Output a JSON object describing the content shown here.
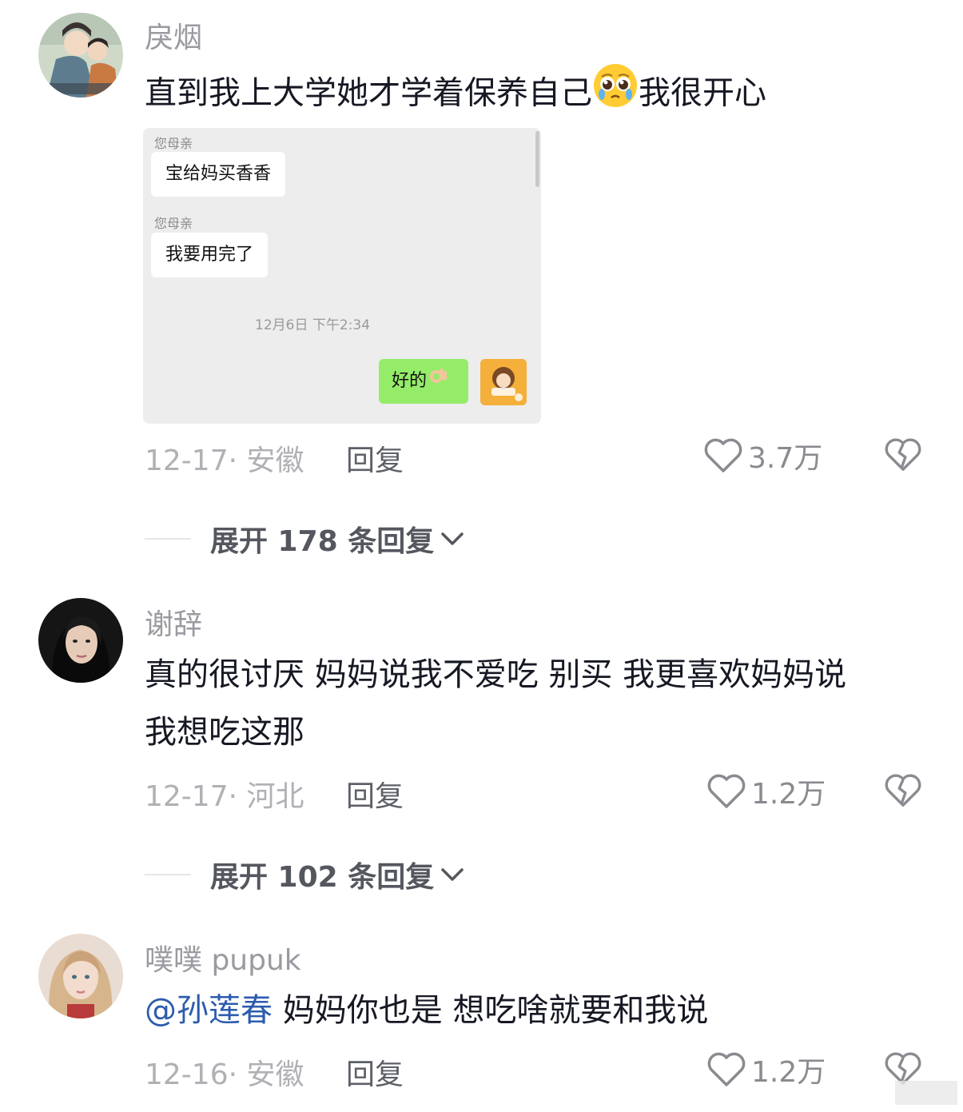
{
  "comments": [
    {
      "username": "戾烟",
      "text_before": "直到我上大学她才学着保养自己",
      "emoji": "pleading-face",
      "text_after": "我很开心",
      "date_location": "12-17· 安徽",
      "reply_label": "回复",
      "likes": "3.7万",
      "expand_label": "展开 178 条回复",
      "chat_screenshot": {
        "sender1": "您母亲",
        "message1": "宝给妈买香香",
        "sender2": "您母亲",
        "message2": "我要用完了",
        "timestamp": "12月6日 下午2:34",
        "my_message": "好的"
      }
    },
    {
      "username": "谢辞",
      "line1": "真的很讨厌 妈妈说我不爱吃 别买 我更喜欢妈妈说",
      "line2": "我想吃这那",
      "date_location": "12-17· 河北",
      "reply_label": "回复",
      "likes": "1.2万",
      "expand_label": "展开 102 条回复"
    },
    {
      "username": "噗噗 pupuk",
      "mention": "@孙莲春",
      "text": " 妈妈你也是 想吃啥就要和我说",
      "date_location": "12-16· 安徽",
      "reply_label": "回复",
      "likes": "1.2万"
    }
  ],
  "colors": {
    "text_primary": "#161823",
    "text_secondary": "#9a9aa0",
    "mention": "#2d5cad",
    "wechat_green": "#95ec69",
    "chat_bg": "#ededed"
  }
}
